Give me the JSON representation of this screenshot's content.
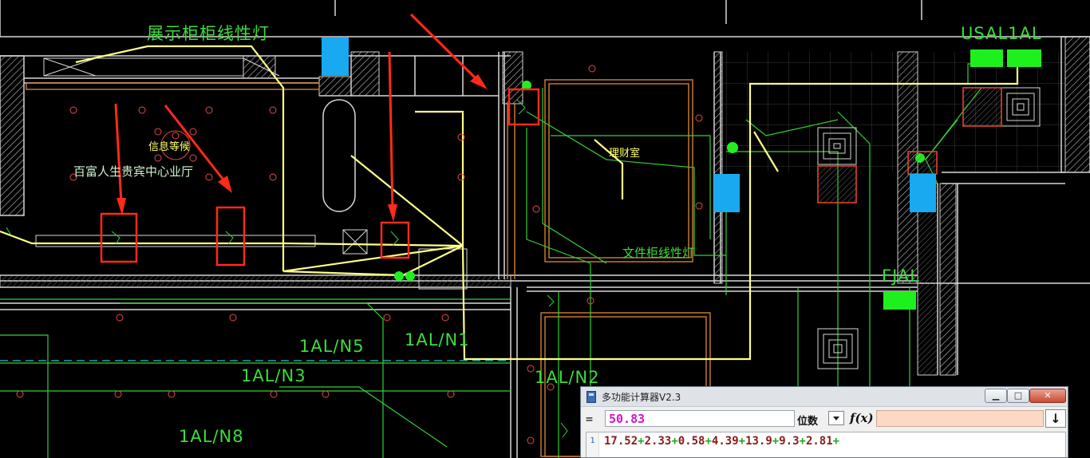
{
  "drawing": {
    "labels": {
      "display_cabinet_light": "展示柜柜线性灯",
      "usal1al": "USAL1AL",
      "lobby": "百富人生贵宾中心业厅",
      "file_cabinet_light": "文件柜线性灯",
      "fjal": "FJAL",
      "n1": "1AL/N1",
      "n5": "1AL/N5",
      "n3": "1AL/N3",
      "n2": "1AL/N2",
      "n8": "1AL/N8",
      "reception": "信息等候",
      "office": "理财室"
    },
    "colors": {
      "background": "#000000",
      "green_line": "#3ddc3d",
      "yellow_wire": "#ffff88",
      "wall": "#e0e0e0",
      "orange_room": "#e08a3a",
      "red_highlight": "#ff2a1a",
      "blue_block": "#19a9f0",
      "green_block": "#1ef01e"
    }
  },
  "calculator": {
    "title": "多功能计算器V2.3",
    "equals": "=",
    "result": "50.83",
    "digits_label": "位数",
    "fx_label": "f(x)",
    "down_symbol": "↓",
    "minimize_symbol": "▁",
    "maximize_symbol": "□",
    "close_symbol": "✕",
    "line_number": "1",
    "expression_terms": [
      "17.52",
      "2.33",
      "0.58",
      "4.39",
      "13.9",
      "9.3",
      "2.81"
    ],
    "expression_trailing_operator": "+"
  }
}
